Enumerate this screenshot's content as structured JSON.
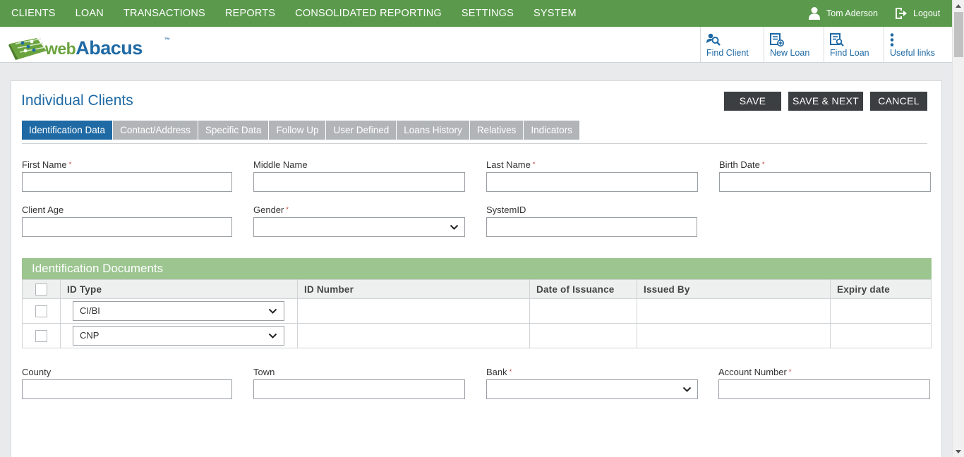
{
  "nav": {
    "menu": [
      "CLIENTS",
      "LOAN",
      "TRANSACTIONS",
      "REPORTS",
      "CONSOLIDATED REPORTING",
      "SETTINGS",
      "SYSTEM"
    ],
    "user_name": "Tom Aderson",
    "logout": "Logout"
  },
  "header": {
    "logo_web": "web",
    "logo_abacus": "Abacus",
    "logo_tm": "™",
    "quick_links": [
      {
        "label": "Find Client",
        "icon": "find-client-icon"
      },
      {
        "label": "New Loan",
        "icon": "new-loan-icon"
      },
      {
        "label": "Find Loan",
        "icon": "find-loan-icon"
      },
      {
        "label": "Useful links",
        "icon": "more-vertical-icon"
      }
    ]
  },
  "page": {
    "title": "Individual Clients",
    "buttons": {
      "save": "SAVE",
      "save_next": "SAVE & NEXT",
      "cancel": "CANCEL"
    },
    "tabs": [
      "Identification Data",
      "Contact/Address",
      "Specific Data",
      "Follow Up",
      "User Defined",
      "Loans History",
      "Relatives",
      "Indicators"
    ],
    "active_tab": "Identification Data"
  },
  "form": {
    "first_name": {
      "label": "First Name",
      "value": "",
      "required": true
    },
    "middle_name": {
      "label": "Middle Name",
      "value": ""
    },
    "last_name": {
      "label": "Last Name",
      "value": "",
      "required": true
    },
    "birth_date": {
      "label": "Birth Date",
      "value": "",
      "required": true
    },
    "client_age": {
      "label": "Client Age",
      "value": ""
    },
    "gender": {
      "label": "Gender",
      "value": "",
      "required": true
    },
    "system_id": {
      "label": "SystemID",
      "value": ""
    },
    "county": {
      "label": "County",
      "value": ""
    },
    "town": {
      "label": "Town",
      "value": ""
    },
    "bank": {
      "label": "Bank",
      "value": "",
      "required": true
    },
    "account_number": {
      "label": "Account Number",
      "value": "",
      "required": true
    },
    "required_mark": "*"
  },
  "id_documents": {
    "title": "Identification Documents",
    "columns": [
      "ID Type",
      "ID Number",
      "Date of Issuance",
      "Issued By",
      "Expiry date"
    ],
    "rows": [
      {
        "id_type": "CI/BI",
        "id_number": "",
        "date_of_issuance": "",
        "issued_by": "",
        "expiry_date": ""
      },
      {
        "id_type": "CNP",
        "id_number": "",
        "date_of_issuance": "",
        "issued_by": "",
        "expiry_date": ""
      }
    ]
  },
  "colors": {
    "nav_green": "#5b9a4d",
    "brand_blue": "#1f6aa5",
    "section_green": "#9cc590",
    "button_dark": "#3c3f41"
  }
}
